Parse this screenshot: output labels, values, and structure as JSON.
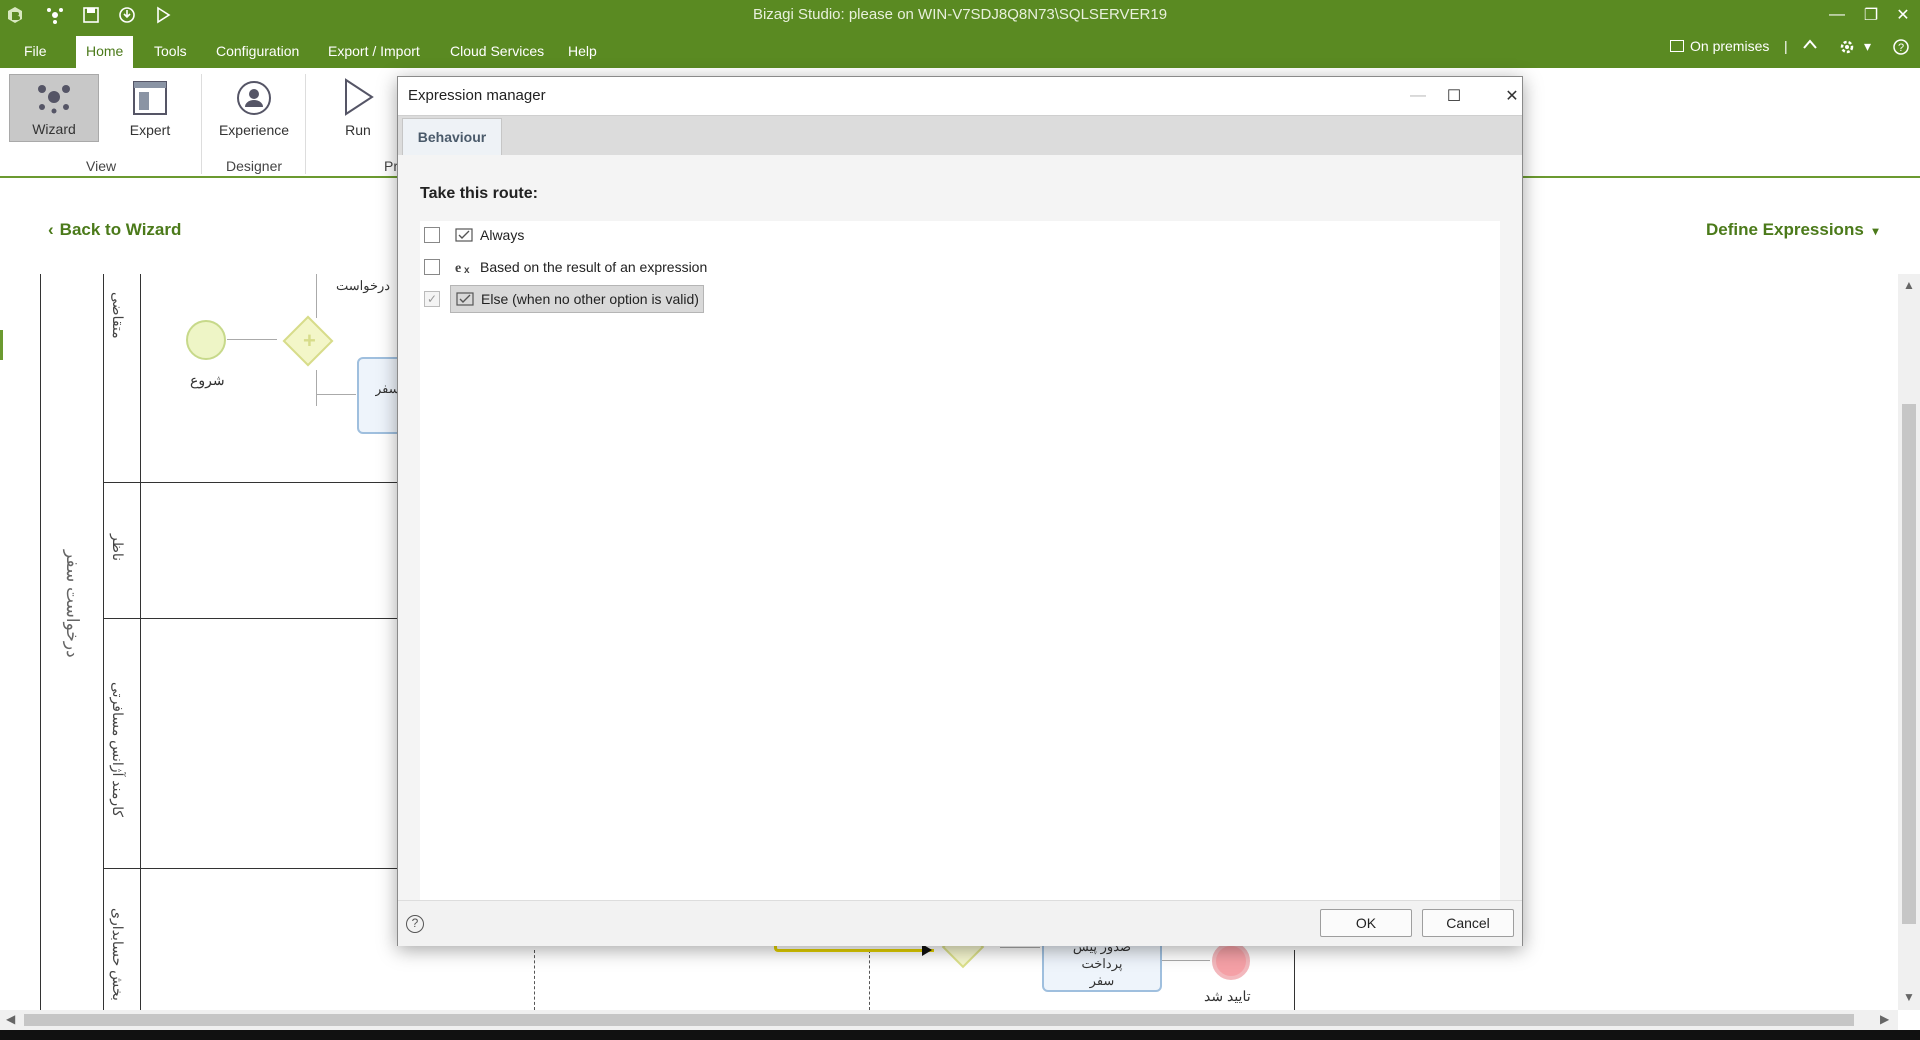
{
  "app": {
    "title": "Bizagi Studio: please  on WIN-V7SDJ8Q8N73\\SQLSERVER19",
    "quick_access_icons": [
      "bizagi-logo-icon",
      "connect-icon",
      "save-icon",
      "publish-icon",
      "run-icon"
    ]
  },
  "menu": {
    "items": [
      "File",
      "Home",
      "Tools",
      "Configuration",
      "Export / Import",
      "Cloud Services",
      "Help"
    ],
    "active": "Home",
    "on_premises": "On premises"
  },
  "ribbon": {
    "wizard": "Wizard",
    "expert": "Expert",
    "view_group": "View",
    "experience": "Experience",
    "designer_group": "Designer",
    "run": "Run",
    "partial_group": "Pr"
  },
  "designer": {
    "back_link": "Back to Wizard",
    "define_expressions": "Define Expressions",
    "pool_name": "درخواست سفر",
    "lanes": [
      "متقاضی",
      "ناظر",
      "کارمند آژانس مسافرتی",
      "بخش حسابداری"
    ],
    "start_label": "شروع",
    "request_label": "درخواست",
    "task_partial": "ن سفر",
    "task_issue": "صدور پیش پرداخت سفر",
    "end_label": "تایید شد"
  },
  "dialog": {
    "title": "Expression manager",
    "tab": "Behaviour",
    "route_label": "Take this route:",
    "options": [
      {
        "label": "Always",
        "checked": false,
        "icon": "always-icon"
      },
      {
        "label": "Based on the result of an expression",
        "checked": false,
        "icon": "expression-icon"
      },
      {
        "label": "Else (when no other option is valid)",
        "checked": true,
        "icon": "else-icon"
      }
    ],
    "help": "?",
    "ok": "OK",
    "cancel": "Cancel"
  },
  "colors": {
    "brand_green": "#5a8a22",
    "link_green": "#4b7a1a"
  }
}
